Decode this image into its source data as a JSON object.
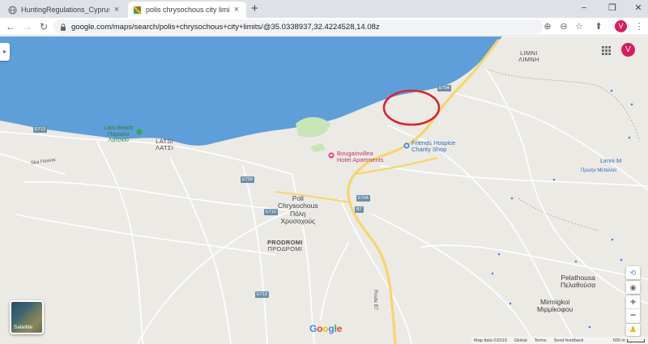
{
  "browser": {
    "tabs": [
      {
        "title": "HuntingRegulations_Cyprus.pdf",
        "active": false,
        "icon": "globe-icon"
      },
      {
        "title": "polis chrysochous city limits - Go",
        "active": true,
        "icon": "maps-icon"
      }
    ],
    "new_tab_glyph": "+",
    "window_controls": [
      "−",
      "❐",
      "✕"
    ],
    "url": "google.com/maps/search/polis+chrysochous+city+limits/@35.0338937,32.4224528,14.08z",
    "avatar_letter": "V"
  },
  "map": {
    "avatar_letter": "V",
    "places": {
      "limni_en": "LIMNI",
      "limni_gr": "ΛΙΜΝΗ",
      "latsi_en": "LATSI",
      "latsi_gr": "ΛΑΤΣΙ",
      "latsi_beach_en": "Latsi Beach",
      "latsi_beach_gr": "Παραλία",
      "latsi_beach_gr2": "Λατσιού",
      "polis_1": "Poli",
      "polis_2": "Chrysochous",
      "polis_3": "Πόλη",
      "polis_4": "Χρυσοχούς",
      "prodromi_en": "PRODROMI",
      "prodromi_gr": "ΠΡΟΔΡΟΜΙ",
      "pelathousa_en": "Pelathousa",
      "pelathousa_gr": "Πελαθούσα",
      "mirmigkoi_en": "Mirmigkoi",
      "mirmigkoi_gr": "Μιρμίκοφου",
      "limni_mine_en": "Limni M",
      "limni_mine_gr": "Πρώην Μεταλλεί"
    },
    "pois": {
      "bougainvillea_1": "Bougainvillea",
      "bougainvillea_2": "Hotel Apartments",
      "friends_1": "Friends Hospice",
      "friends_2": "Charity Shop"
    },
    "roads": {
      "e704_a": "E704",
      "e713_a": "E713",
      "e709_a": "E709",
      "e712_a": "E712",
      "e713_b": "E713",
      "e704_b": "E704",
      "b7_a": "B7",
      "e713_c": "E713",
      "route_b7": "Route B7",
      "seaside": "Ska Γιαννια"
    },
    "satellite_label": "Satellite",
    "google_logo": [
      "G",
      "o",
      "o",
      "g",
      "l",
      "e"
    ],
    "google_colors": [
      "#4285F4",
      "#EA4335",
      "#FBBC05",
      "#4285F4",
      "#34A853",
      "#EA4335"
    ],
    "footer": {
      "data": "Map data ©2019",
      "global": "Global",
      "terms": "Terms",
      "feedback": "Send feedback",
      "scale": "500 m"
    },
    "colors": {
      "sea": "#5f9fd9",
      "land": "#eceae5",
      "main_road": "#f6d66b",
      "annotation_circle": "#d9232e"
    }
  }
}
